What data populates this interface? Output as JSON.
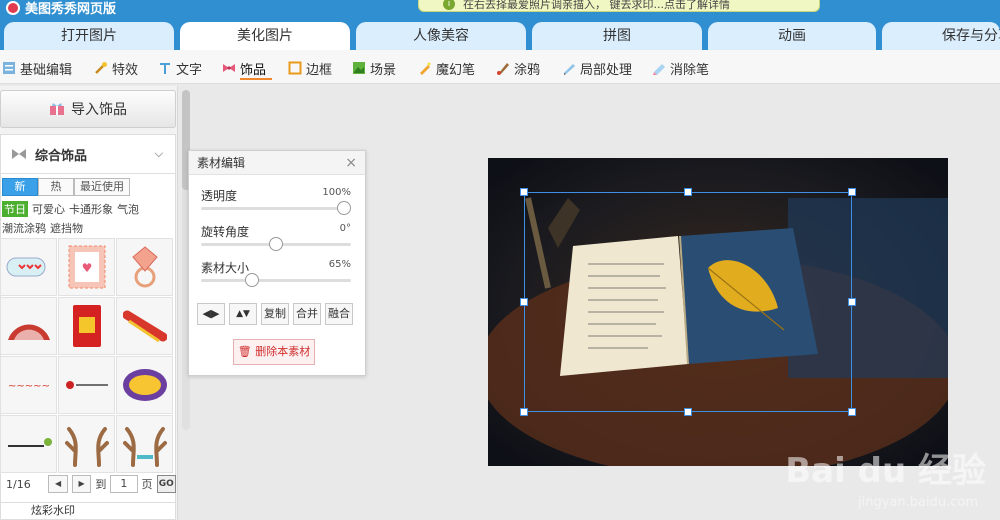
{
  "header": {
    "app_title": "美图秀秀网页版",
    "notice_text": "在右去择最爱照片调亲描入， 键去求印...点击了解详情"
  },
  "main_tabs": [
    {
      "label": "打开图片"
    },
    {
      "label": "美化图片"
    },
    {
      "label": "人像美容"
    },
    {
      "label": "拼图"
    },
    {
      "label": "动画"
    },
    {
      "label": "保存与分享"
    }
  ],
  "sub_toolbar": [
    {
      "label": "基础编辑",
      "icon": "sliders-icon"
    },
    {
      "label": "特效",
      "icon": "magic-wand-icon"
    },
    {
      "label": "文字",
      "icon": "text-T-icon"
    },
    {
      "label": "饰品",
      "icon": "bow-icon"
    },
    {
      "label": "边框",
      "icon": "frame-icon"
    },
    {
      "label": "场景",
      "icon": "scene-icon"
    },
    {
      "label": "魔幻笔",
      "icon": "magic-pen-icon"
    },
    {
      "label": "涂鸦",
      "icon": "brush-icon"
    },
    {
      "label": "局部处理",
      "icon": "local-adjust-icon"
    },
    {
      "label": "消除笔",
      "icon": "eraser-pen-icon"
    }
  ],
  "left_panel": {
    "import_label": "导入饰品",
    "category_title": "综合饰品",
    "segments": [
      {
        "label": "新",
        "active": true
      },
      {
        "label": "热",
        "active": false
      },
      {
        "label": "最近使用",
        "active": false
      }
    ],
    "tags_row1": [
      {
        "label": "节日",
        "active": true
      },
      {
        "label": "可爱心",
        "active": false
      },
      {
        "label": "卡通形象",
        "active": false
      },
      {
        "label": "气泡",
        "active": false
      }
    ],
    "tags_row2": [
      {
        "label": "潮流涂鸦"
      },
      {
        "label": "遮挡物"
      }
    ],
    "page_indicator": "1/16",
    "goto_label": "到",
    "page_input": "1",
    "page_suffix": "页",
    "go_label": "GO",
    "bottom_category": "炫彩水印"
  },
  "editor": {
    "title": "素材编辑",
    "opacity_label": "透明度",
    "opacity_value": "100%",
    "opacity": 1.0,
    "rotation_label": "旋转角度",
    "rotation_value": "0°",
    "rotation": 0.5,
    "size_label": "素材大小",
    "size_value": "65%",
    "size": 0.32,
    "buttons": [
      "复制",
      "合并",
      "融合"
    ],
    "delete_label": "删除本素材"
  },
  "watermark": {
    "brand": "Bai du 经验",
    "url": "jingyan.baidu.com"
  },
  "colors": {
    "header_blue": "#2f8fd0",
    "tab_active": "#ffffff",
    "accent_orange": "#f0872e",
    "selection_blue": "#3f8fe6",
    "delete_red": "#d0302f",
    "segment_blue": "#3aa0e8",
    "tag_green": "#4caf2f"
  }
}
